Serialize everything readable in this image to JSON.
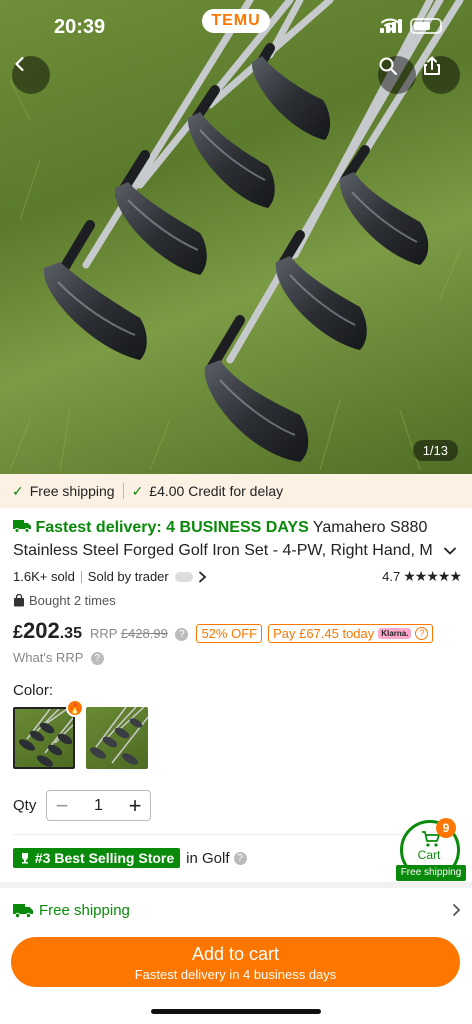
{
  "status_bar": {
    "time": "20:39",
    "brand": "TEMU"
  },
  "gallery": {
    "counter": "1/13"
  },
  "promo_band": {
    "item1": "Free shipping",
    "item2": "£4.00 Credit for delay"
  },
  "product": {
    "fast_delivery": "Fastest delivery: 4 BUSINESS DAYS",
    "title_part1": " Yamahero S880",
    "title_line2": "Stainless Steel Forged Golf Iron Set - 4-PW, Right Hand, M",
    "sold": "1.6K+ sold",
    "sold_by": "Sold by trader",
    "rating": "4.7",
    "stars": "★★★★★",
    "bought": "Bought 2 times"
  },
  "price": {
    "currency": "£",
    "whole": "202",
    "fraction": ".35",
    "rrp_label": "RRP",
    "rrp_value": "£428.99",
    "discount": "52% OFF",
    "pay_today": "Pay £67.45 today",
    "klarna": "Klarna.",
    "whats_rrp": "What's RRP"
  },
  "color": {
    "label": "Color:"
  },
  "quantity": {
    "label": "Qty",
    "value": "1",
    "minus": "−",
    "plus": "+"
  },
  "store": {
    "badge": "#3 Best Selling Store",
    "category": "in Golf"
  },
  "cart": {
    "label": "Cart",
    "count": "9",
    "shipping": "Free shipping"
  },
  "shipping_row": {
    "label": "Free shipping"
  },
  "add_to_cart": {
    "label": "Add to cart",
    "sublabel": "Fastest delivery in 4 business days"
  },
  "colors": {
    "accent": "#fb7701",
    "green": "#0a8a0a"
  }
}
